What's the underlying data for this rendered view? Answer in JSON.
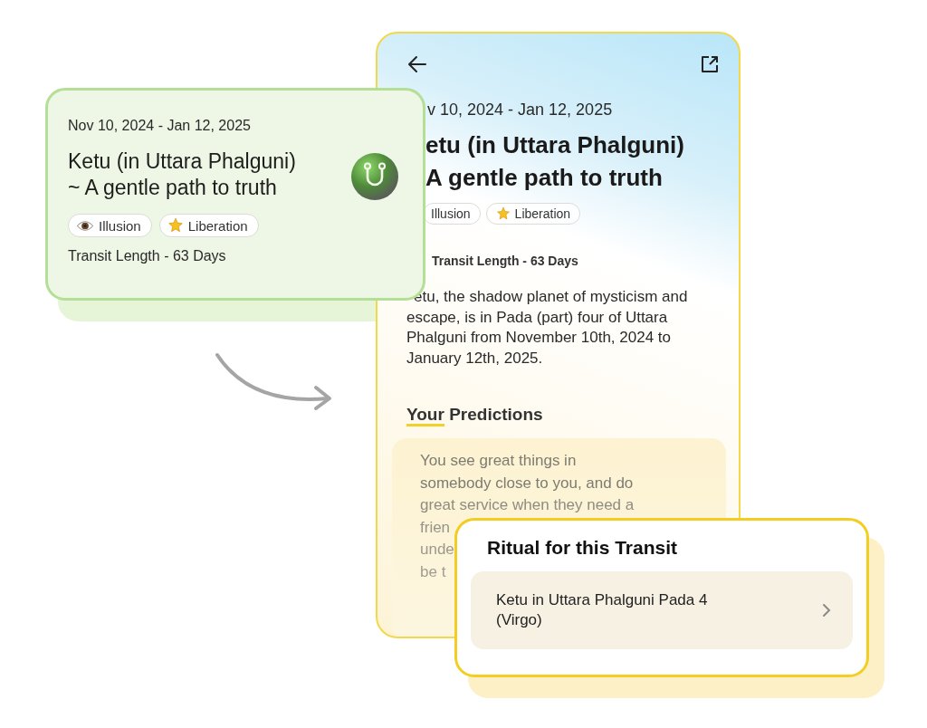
{
  "summary_card": {
    "date_range": "Nov 10, 2024 - Jan 12, 2025",
    "title_lines": [
      "Ketu (in Uttara Phalguni)",
      "~ A gentle path to truth"
    ],
    "tags": [
      {
        "kind": "eye",
        "label": "Illusion"
      },
      {
        "kind": "sparkle",
        "label": "Liberation"
      }
    ],
    "transit_length": "Transit Length - 63 Days"
  },
  "detail_screen": {
    "date_range": "v 10, 2024 - Jan 12, 2025",
    "title_lines": [
      "etu (in Uttara Phalguni)",
      "A gentle path to truth"
    ],
    "tags": [
      {
        "kind": "plain",
        "label": "Illusion"
      },
      {
        "kind": "sparkle",
        "label": "Liberation"
      }
    ],
    "transit_length": "Transit Length - 63 Days",
    "description": "etu, the shadow planet of mysticism and escape, is in Pada (part) four of Uttara Phalguni from November 10th, 2024 to January 12th, 2025.",
    "predictions_heading": {
      "accent": "Your",
      "rest": "Predictions"
    },
    "prediction_lines": [
      "You see great things in",
      "somebody close to you, and do",
      "great service when they need a",
      "frien",
      "unde",
      "be t"
    ]
  },
  "ritual_card": {
    "title": "Ritual for this Transit",
    "item": "Ketu in Uttara Phalguni Pada 4 (Virgo)"
  }
}
